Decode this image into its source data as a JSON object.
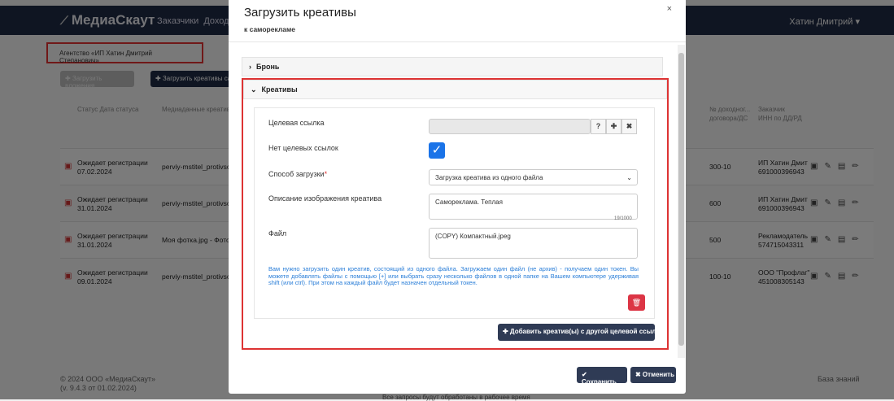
{
  "nav": {
    "brand": "МедиаСкаут",
    "links": [
      "Заказчики",
      "Доходны"
    ],
    "user": "Хатин Дмитрий ▾"
  },
  "breadcrumb": "Агентство «ИП Хатин Дмитрий Степанович»",
  "buttons": {
    "upload_attachments": "✚ Загрузить вложения",
    "upload_creatives": "✚ Загрузить креативы са"
  },
  "table": {
    "headers": [
      "Статус\nДата статуса",
      "Медиаданные\nкреатива",
      "№ доходног...\nдоговора/ДС",
      "Заказчик\nИНН по ДД/РД"
    ],
    "rows": [
      {
        "status": "Ожидает регистрации",
        "date": "07.02.2024",
        "media": "perviy-mstitel_protivsot",
        "contract": "300-10",
        "client": "ИП Хатин Дмит",
        "inn": "691000396943"
      },
      {
        "status": "Ожидает регистрации",
        "date": "31.01.2024",
        "media": "perviy-mstitel_protivsot",
        "contract": "600",
        "client": "ИП Хатин Дмит",
        "inn": "691000396943"
      },
      {
        "status": "Ожидает регистрации",
        "date": "31.01.2024",
        "media": "Моя фотка.jpg - Фотогр",
        "contract": "500",
        "client": "Рекламодатель",
        "inn": "574715043311"
      },
      {
        "status": "Ожидает регистрации",
        "date": "09.01.2024",
        "media": "perviy-mstitel_protivsot",
        "contract": "100-10",
        "client": "ООО \"Профлаг\"",
        "inn": "451008305143"
      }
    ]
  },
  "footer": {
    "copyright": "© 2024 ООО «МедиаСкаут»",
    "version": "(v. 9.4.3 от 01.02.2024)",
    "kb": "База знаний",
    "note": "Все запросы будут обработаны в рабочее время"
  },
  "modal": {
    "title": "Загрузить креативы",
    "subtitle": "к саморекламе",
    "close": "×",
    "sections": {
      "booking": "Бронь",
      "creatives": "Креативы"
    },
    "fields": {
      "target_link_label": "Целевая ссылка",
      "target_link_value": "",
      "no_links_label": "Нет целевых ссылок",
      "no_links_checked": true,
      "upload_method_label": "Способ загрузки",
      "upload_method_value": "Загрузка креатива из одного файла",
      "desc_label": "Описание изображения креатива",
      "desc_value": "Самореклама. Теплая",
      "desc_counter": "19/1000",
      "file_label": "Файл",
      "file_value": "(COPY) Компактный.jpeg"
    },
    "hint": "Вам нужно загрузить один креатив, состоящий из одного файла. Загружаем один файл (не архив) - получаем один токен. Вы можете добавлять файлы с помощью [+] или выбрать сразу несколько файлов в одной папке на Вашем компьютере удерживая shift (или ctrl). При этом на каждый файл будет назначен отдельный токен.",
    "add_button": "✚ Добавить креатив(ы) с другой целевой ссылкой",
    "save": "✔ Сохранить",
    "cancel": "✖ Отменить"
  }
}
